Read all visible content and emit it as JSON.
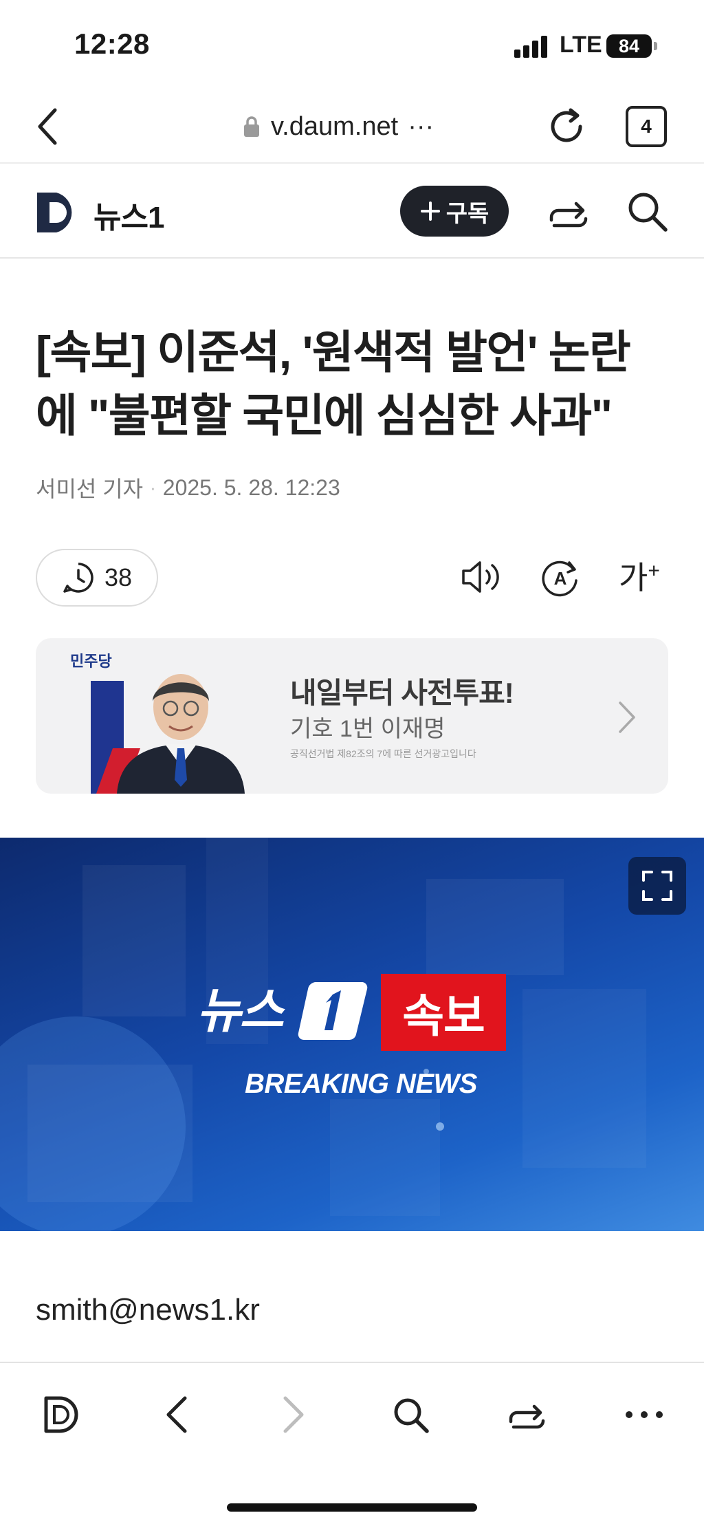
{
  "status_bar": {
    "time": "12:28",
    "network": "LTE",
    "battery": "84"
  },
  "url_bar": {
    "domain": "v.daum.net",
    "more": "···",
    "tab_count": "4"
  },
  "site_header": {
    "site_name": "뉴스1",
    "subscribe_label": "구독"
  },
  "article": {
    "headline_line1": "[속보] 이준석, '원색적 발언' 논란",
    "headline_line2": "에 \"불편할 국민에 심심한 사과\"",
    "reporter": "서미선 기자",
    "date": "2025. 5. 28. 12:23",
    "comment_count": "38",
    "font_size_label": "가",
    "reporter_email": "smith@news1.kr"
  },
  "ad": {
    "party": "민주당",
    "title": "내일부터 사전투표!",
    "subtitle": "기호 1번 이재명",
    "fine_print": "공직선거법 제82조의 7에 따른 선거광고입니다"
  },
  "hero_image": {
    "brand": "뉴스",
    "badge": "속보",
    "caption": "BREAKING NEWS"
  },
  "icons": {
    "back": "back-chevron-icon",
    "lock": "lock-icon",
    "reload": "reload-icon",
    "share": "share-icon",
    "search": "search-icon",
    "clock": "clock-icon",
    "speaker": "speaker-icon",
    "translate": "translate-icon",
    "fullscreen": "fullscreen-icon"
  },
  "colors": {
    "subscribe_bg": "#1f2229",
    "breaking_red": "#e1141d",
    "hero_blue": "#1448a8"
  }
}
